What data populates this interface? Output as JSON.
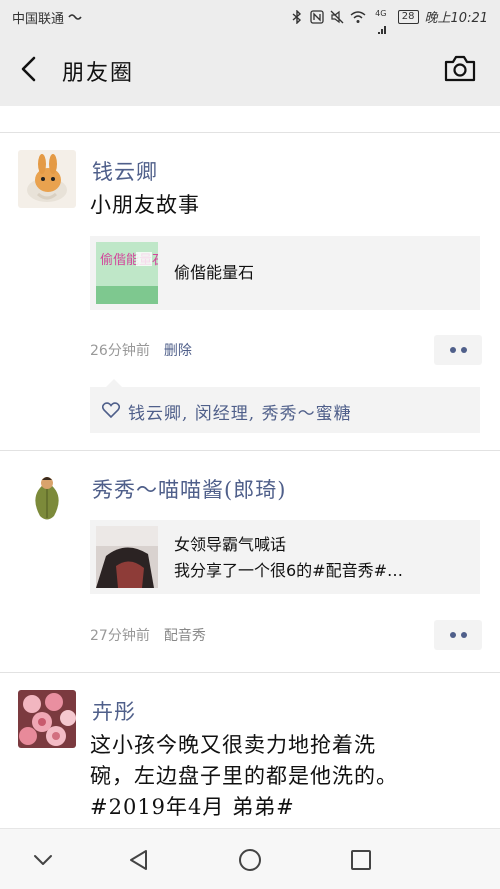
{
  "status_bar": {
    "carrier": "中国联通",
    "network_label": "4G",
    "battery": "28",
    "time": "晚上10:21"
  },
  "header": {
    "title": "朋友圈"
  },
  "posts": [
    {
      "author": "钱云卿",
      "text": "小朋友故事",
      "share_text": "偷偕能量石",
      "share_thumb_text": "偷偕能量石",
      "time": "26分钟前",
      "delete_label": "删除",
      "likes": "钱云卿, 闵经理, 秀秀～蜜糖"
    },
    {
      "author": "秀秀～喵喵酱(郎琦)",
      "share_line1": "女领导霸气喊话",
      "share_line2": "我分享了一个很6的#配音秀#…",
      "time": "27分钟前",
      "source": "配音秀"
    },
    {
      "author": "卉彤",
      "text_line1": "这小孩今晚又很卖力地抢着洗",
      "text_line2": "碗，左边盘子里的都是他洗的。",
      "text_line3": "#2019年4月 弟弟#"
    }
  ]
}
